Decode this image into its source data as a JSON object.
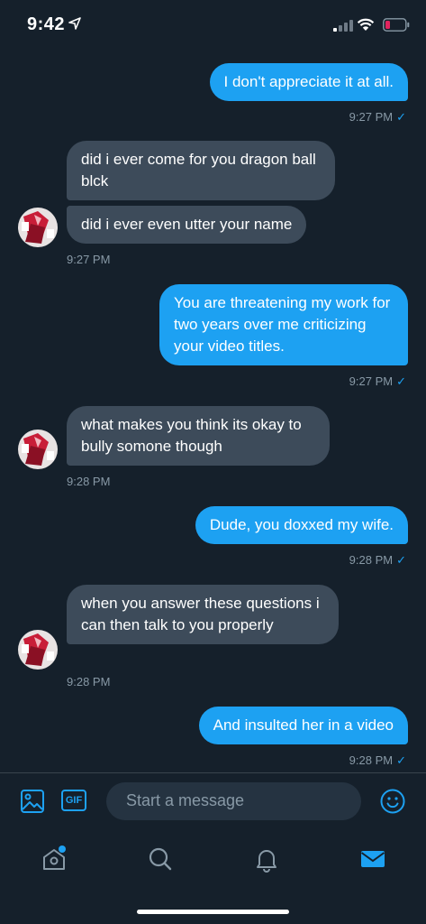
{
  "status_bar": {
    "time": "9:42"
  },
  "messages": [
    {
      "text": "I don't appreciate it at all.",
      "time": "9:27 PM"
    },
    {
      "text": "did i ever come for you dragon ball blck"
    },
    {
      "text": "did i ever even utter your name",
      "time": "9:27 PM"
    },
    {
      "text": "You are threatening my work for two years over me criticizing your video titles.",
      "time": "9:27 PM"
    },
    {
      "text": "what makes you think its okay to bully somone though",
      "time": "9:28 PM"
    },
    {
      "text": "Dude, you doxxed my wife.",
      "time": "9:28 PM"
    },
    {
      "text": "when you answer these questions i can then talk to you properly",
      "time": "9:28 PM"
    },
    {
      "text": "And insulted her in a video",
      "time": "9:28 PM"
    }
  ],
  "composer": {
    "placeholder": "Start a message",
    "gif_label": "GIF"
  },
  "icons": [
    "location-arrow-icon",
    "signal-icon",
    "wifi-icon",
    "battery-icon",
    "image-icon",
    "gif-icon",
    "emoji-icon",
    "home-icon",
    "search-icon",
    "bell-icon",
    "mail-icon"
  ],
  "colors": {
    "background": "#15202b",
    "accent": "#1da1f2",
    "incoming_bubble": "#3d4b5a",
    "muted": "#8899a6",
    "battery_low": "#e0245e"
  }
}
